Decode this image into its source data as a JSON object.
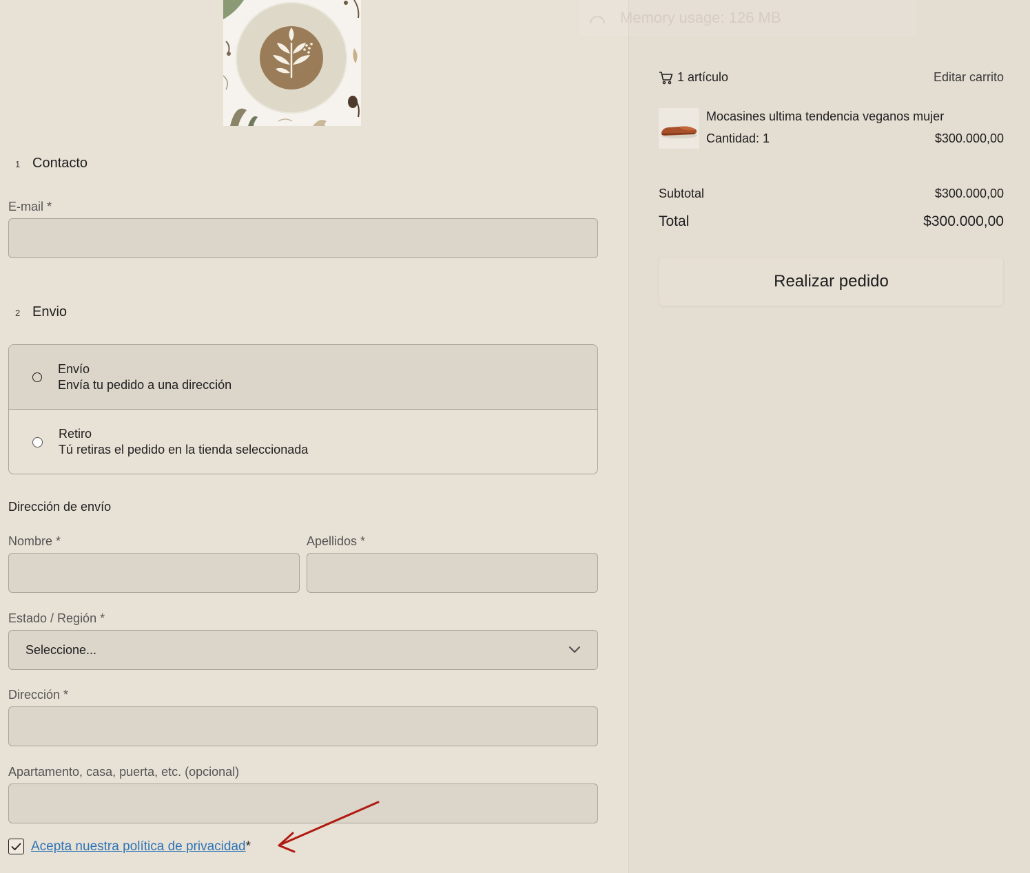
{
  "contact": {
    "step": "1",
    "title": "Contacto",
    "email_label": "E-mail *",
    "email_value": ""
  },
  "shipping": {
    "step": "2",
    "title": "Envio",
    "options": [
      {
        "title": "Envío",
        "desc": "Envía tu pedido a una dirección",
        "selected": true
      },
      {
        "title": "Retiro",
        "desc": "Tú retiras el pedido en la tienda seleccionada",
        "selected": false
      }
    ]
  },
  "address": {
    "title": "Dirección de envío",
    "first_name_label": "Nombre *",
    "last_name_label": "Apellidos *",
    "region_label": "Estado / Región *",
    "region_value": "Seleccione...",
    "address_label": "Dirección *",
    "apartment_label": "Apartamento, casa, puerta, etc. (opcional)"
  },
  "privacy": {
    "link": "Acepta nuestra política de privacidad",
    "required": "*",
    "checked": true
  },
  "ghost_overlay": {
    "text": "Memory usage: 126 MB"
  },
  "cart": {
    "count_label": "1 artículo",
    "edit_label": "Editar carrito",
    "item": {
      "name": "Mocasines ultima tendencia veganos mujer",
      "quantity": "Cantidad: 1",
      "price": "$300.000,00"
    },
    "subtotal_label": "Subtotal",
    "subtotal_value": "$300.000,00",
    "total_label": "Total",
    "total_value": "$300.000,00",
    "order_button": "Realizar pedido"
  },
  "colors": {
    "background": "#e8e1d6",
    "field_bg": "#dbd5ca",
    "link": "#2d74b5",
    "logo_brown": "#9a7c58",
    "annotation_arrow": "#b01a10"
  },
  "icons": [
    "cart-icon",
    "chevron-down-icon",
    "check-icon",
    "plant-logo",
    "loafer-shoe-image"
  ]
}
